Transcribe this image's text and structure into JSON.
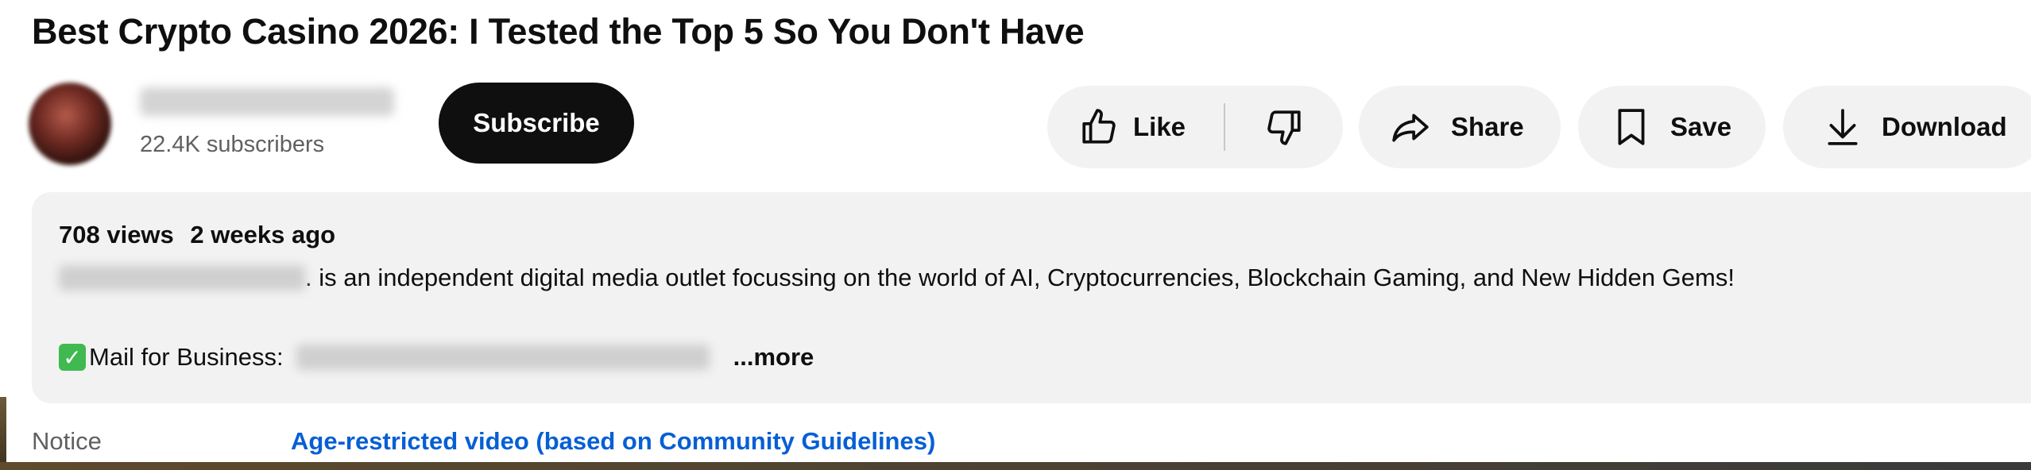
{
  "video": {
    "title": "Best Crypto Casino 2026: I Tested the Top 5 So You Don't Have"
  },
  "channel": {
    "subscribers": "22.4K subscribers",
    "subscribe_label": "Subscribe"
  },
  "actions": {
    "like_label": "Like",
    "share_label": "Share",
    "save_label": "Save",
    "download_label": "Download"
  },
  "description": {
    "views": "708 views",
    "age": "2 weeks ago",
    "text": ". is an independent digital media outlet focussing on the world of AI, Cryptocurrencies,  Blockchain Gaming, and New Hidden Gems!",
    "mail_label": "Mail for Business:",
    "more_label": "...more"
  },
  "notice": {
    "label": "Notice",
    "value": "Age-restricted video (based on Community Guidelines)"
  },
  "icons": {
    "like": "thumbs-up-icon",
    "dislike": "thumbs-down-icon",
    "share": "share-arrow-icon",
    "save": "bookmark-icon",
    "download": "download-icon",
    "check": "checkmark-emoji-icon"
  },
  "colors": {
    "subscribe_bg": "#0f0f0f",
    "pill_bg": "#f2f2f2",
    "link": "#065fd4",
    "check": "#3fb950"
  }
}
